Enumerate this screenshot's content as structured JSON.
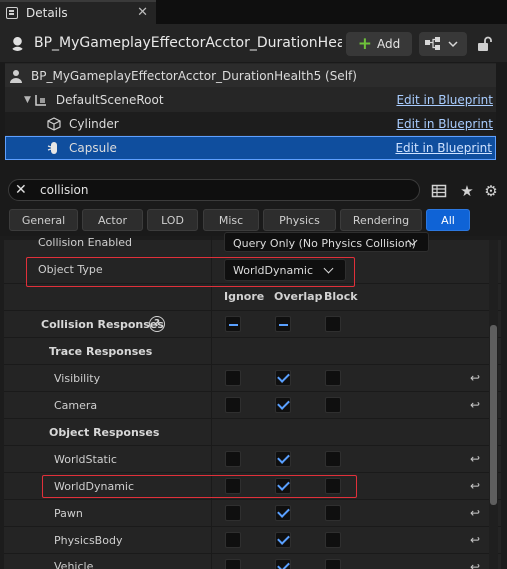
{
  "tab": {
    "title": "Details",
    "close": "✕"
  },
  "header": {
    "actor_name": "BP_MyGameplayEffectorAcctor_DurationHea",
    "add_label": "Add"
  },
  "tree": [
    {
      "label": "BP_MyGameplayEffectorAcctor_DurationHealth5 (Self)",
      "link": ""
    },
    {
      "label": "DefaultSceneRoot",
      "link": "Edit in Blueprint"
    },
    {
      "label": "Cylinder",
      "link": "Edit in Blueprint"
    },
    {
      "label": "Capsule",
      "link": "Edit in Blueprint"
    }
  ],
  "search": {
    "value": "collision"
  },
  "filters": [
    "General",
    "Actor",
    "LOD",
    "Misc",
    "Physics",
    "Rendering",
    "All"
  ],
  "active_filter": "All",
  "props": {
    "collision_enabled_label": "Collision Enabled",
    "collision_enabled_value": "Query Only (No Physics Collision)",
    "object_type_label": "Object Type",
    "object_type_value": "WorldDynamic",
    "col_ignore": "Ignore",
    "col_overlap": "Overlap",
    "col_block": "Block",
    "collision_responses_label": "Collision Responses",
    "trace_responses_label": "Trace Responses",
    "object_responses_label": "Object Responses",
    "rows": [
      {
        "label": "Visibility",
        "ignore": false,
        "overlap": true,
        "block": false
      },
      {
        "label": "Camera",
        "ignore": false,
        "overlap": true,
        "block": false
      },
      {
        "label": "WorldStatic",
        "ignore": false,
        "overlap": true,
        "block": false
      },
      {
        "label": "WorldDynamic",
        "ignore": false,
        "overlap": true,
        "block": false
      },
      {
        "label": "Pawn",
        "ignore": false,
        "overlap": true,
        "block": false
      },
      {
        "label": "PhysicsBody",
        "ignore": false,
        "overlap": true,
        "block": false
      },
      {
        "label": "Vehicle",
        "ignore": false,
        "overlap": true,
        "block": false
      }
    ]
  },
  "colors": {
    "accent": "#0f63d6",
    "highlight": "#e0303a",
    "check": "#5aa0ff"
  }
}
